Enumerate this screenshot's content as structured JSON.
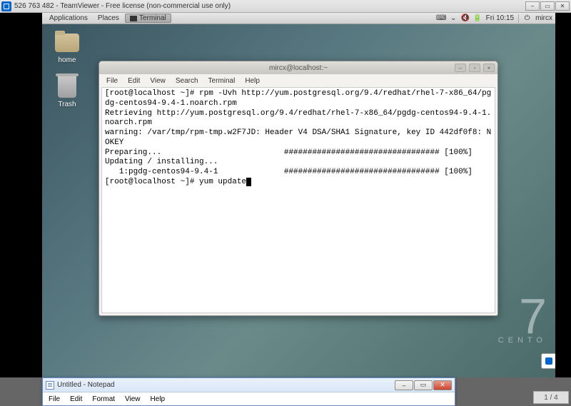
{
  "outer": {
    "title": "526 763 482 - TeamViewer - Free license (non-commercial use only)"
  },
  "gnome_panel": {
    "apps": "Applications",
    "places": "Places",
    "task": "Terminal",
    "clock": "Fri 10:15",
    "user": "mircx"
  },
  "desktop_icons": {
    "home": "home",
    "trash": "Trash"
  },
  "centos": {
    "num": "7",
    "txt": "CENTO"
  },
  "terminal": {
    "title": "mircx@localhost:~",
    "menu": {
      "file": "File",
      "edit": "Edit",
      "view": "View",
      "search": "Search",
      "terminal": "Terminal",
      "help": "Help"
    },
    "lines": [
      "[root@localhost ~]# rpm -Uvh http://yum.postgresql.org/9.4/redhat/rhel-7-x86_64/pgdg-centos94-9.4-1.noarch.rpm",
      "Retrieving http://yum.postgresql.org/9.4/redhat/rhel-7-x86_64/pgdg-centos94-9.4-1.noarch.rpm",
      "warning: /var/tmp/rpm-tmp.w2F7JD: Header V4 DSA/SHA1 Signature, key ID 442df0f8: NOKEY",
      "Preparing...                          ################################# [100%]",
      "Updating / installing...",
      "   1:pgdg-centos94-9.4-1              ################################# [100%]",
      "[root@localhost ~]# yum update"
    ]
  },
  "notepad": {
    "title": "Untitled - Notepad",
    "menu": {
      "file": "File",
      "edit": "Edit",
      "format": "Format",
      "view": "View",
      "help": "Help"
    }
  },
  "page_indicator": "1 / 4"
}
